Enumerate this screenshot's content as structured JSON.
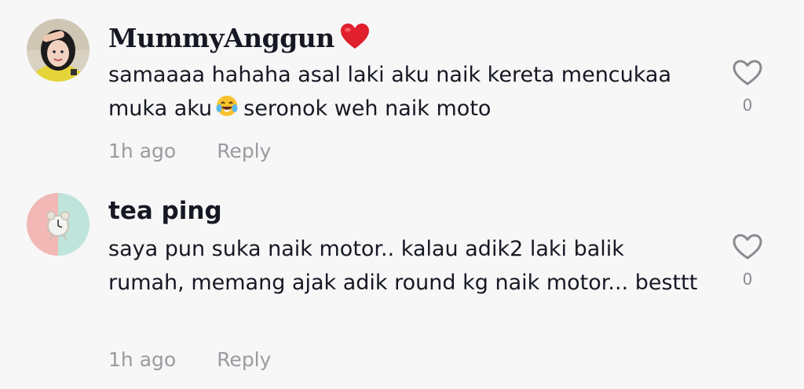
{
  "comments": [
    {
      "username": "MummyAnggun",
      "username_emoji": "red-heart-emoji",
      "text_before_emoji": "samaaaa hahaha asal laki aku naik kereta mencukaa muka aku",
      "inline_emoji": "tears-of-joy-emoji",
      "text_after_emoji": "seronok weh naik moto",
      "time": "1h ago",
      "reply_label": "Reply",
      "like_count": "0"
    },
    {
      "username": "tea ping",
      "text": "saya pun suka naik motor.. kalau adik2 laki balik rumah, memang ajak adik round kg naik motor... besttt",
      "time": "1h ago",
      "reply_label": "Reply",
      "like_count": "0"
    }
  ],
  "colors": {
    "background": "#f7f7f7",
    "text_primary": "#161823",
    "text_secondary": "#9a9ba1",
    "icon_gray": "#8a8b91"
  }
}
